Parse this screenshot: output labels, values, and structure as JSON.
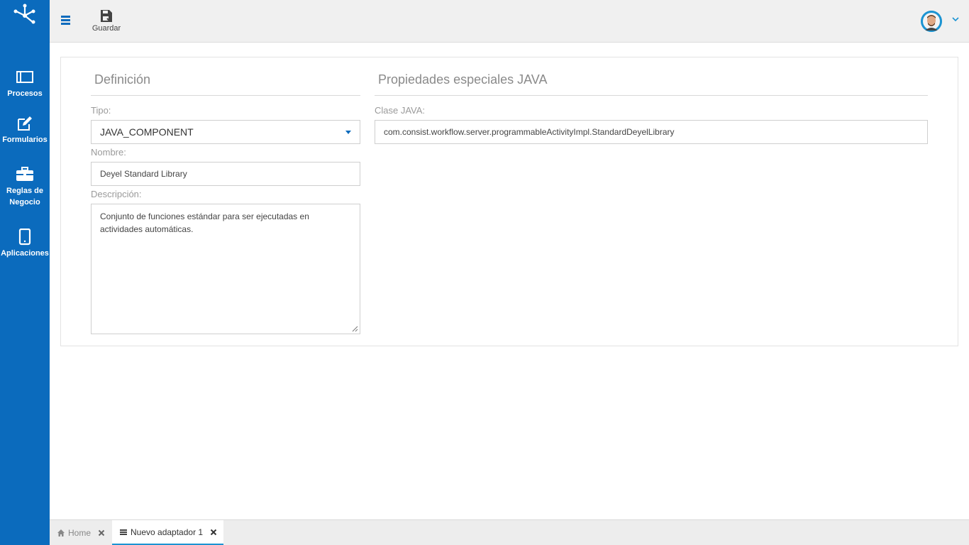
{
  "sidebar": {
    "items": [
      {
        "label": "Procesos",
        "icon": "window-icon"
      },
      {
        "label": "Formularios",
        "icon": "edit-icon"
      },
      {
        "label": "Reglas de Negocio",
        "icon": "briefcase-icon"
      },
      {
        "label": "Aplicaciones",
        "icon": "tablet-icon"
      }
    ]
  },
  "toolbar": {
    "save_label": "Guardar"
  },
  "definicion": {
    "title": "Definición",
    "tipo_label": "Tipo:",
    "tipo_value": "JAVA_COMPONENT",
    "nombre_label": "Nombre:",
    "nombre_value": "Deyel Standard Library",
    "descripcion_label": "Descripción:",
    "descripcion_value": "Conjunto de funciones estándar para ser ejecutadas en actividades automáticas."
  },
  "java": {
    "title": "Propiedades especiales JAVA",
    "clase_label": "Clase JAVA:",
    "clase_value": "com.consist.workflow.server.programmableActivityImpl.StandardDeyelLibrary"
  },
  "tabs": [
    {
      "label": "Home",
      "icon": "home-icon"
    },
    {
      "label": "Nuevo adaptador 1",
      "icon": "list-icon"
    }
  ],
  "colors": {
    "primary": "#0b6bbd",
    "accent": "#1c94d2"
  }
}
